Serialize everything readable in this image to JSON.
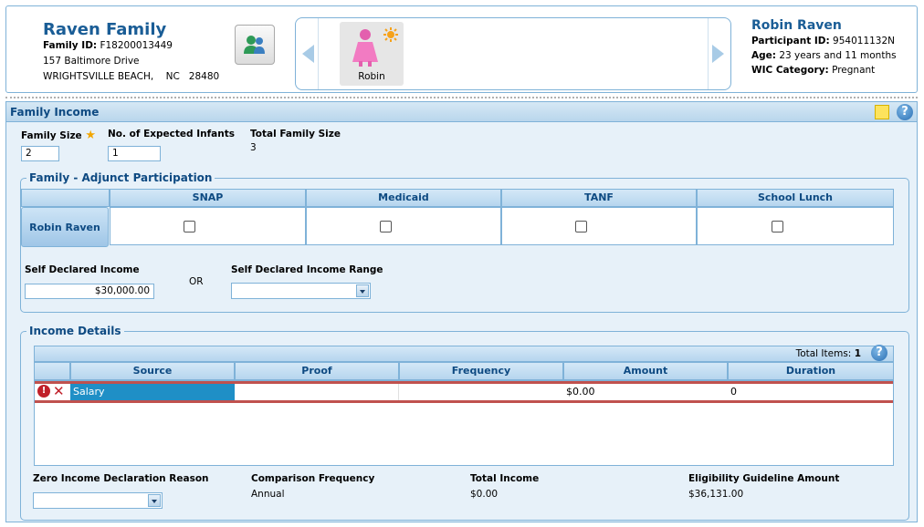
{
  "family": {
    "name": "Raven Family",
    "id_label": "Family ID:",
    "id_value": "F18200013449",
    "address1": "157 Baltimore Drive",
    "address2": "WRIGHTSVILLE BEACH,    NC   28480"
  },
  "carousel": {
    "members": [
      {
        "label": "Robin"
      }
    ]
  },
  "participant": {
    "name": "Robin Raven",
    "id_label": "Participant ID:",
    "id_value": "954011132N",
    "age_label": "Age:",
    "age_value": "23 years and 11 months",
    "category_label": "WIC Category:",
    "category_value": "Pregnant"
  },
  "panel": {
    "title": "Family Income",
    "family_size_label": "Family Size",
    "family_size_value": "2",
    "expected_infants_label": "No. of Expected Infants",
    "expected_infants_value": "1",
    "total_family_size_label": "Total Family Size",
    "total_family_size_value": "3"
  },
  "adjunct": {
    "legend": "Family - Adjunct Participation",
    "columns": [
      "SNAP",
      "Medicaid",
      "TANF",
      "School Lunch"
    ],
    "row_label": "Robin Raven",
    "checked": [
      false,
      false,
      false,
      false
    ],
    "self_income_label": "Self Declared Income",
    "self_income_value": "$30,000.00",
    "or_label": "OR",
    "income_range_label": "Self Declared Income Range",
    "income_range_value": ""
  },
  "income_details": {
    "legend": "Income Details",
    "total_items_label": "Total Items:",
    "total_items_value": "1",
    "columns": [
      "Source",
      "Proof",
      "Frequency",
      "Amount",
      "Duration"
    ],
    "rows": [
      {
        "source": "Salary",
        "proof": "",
        "frequency": "",
        "amount": "$0.00",
        "duration": "0"
      }
    ],
    "zero_income_label": "Zero Income Declaration Reason",
    "zero_income_value": "",
    "comparison_frequency_label": "Comparison Frequency",
    "comparison_frequency_value": "Annual",
    "total_income_label": "Total Income",
    "total_income_value": "$0.00",
    "eligibility_label": "Eligibility Guideline Amount",
    "eligibility_value": "$36,131.00"
  },
  "colors": {
    "accent": "#1a5d96",
    "panel_bg": "#e7f1f9",
    "border": "#7fb2d8",
    "selected": "#1f8fc6",
    "error": "#c0514e"
  },
  "icons": [
    "family-members-icon",
    "pregnant-woman-icon",
    "sun-badge-icon",
    "note-icon",
    "help-icon",
    "error-icon",
    "delete-icon",
    "star-icon",
    "dropdown-arrow-icon"
  ]
}
